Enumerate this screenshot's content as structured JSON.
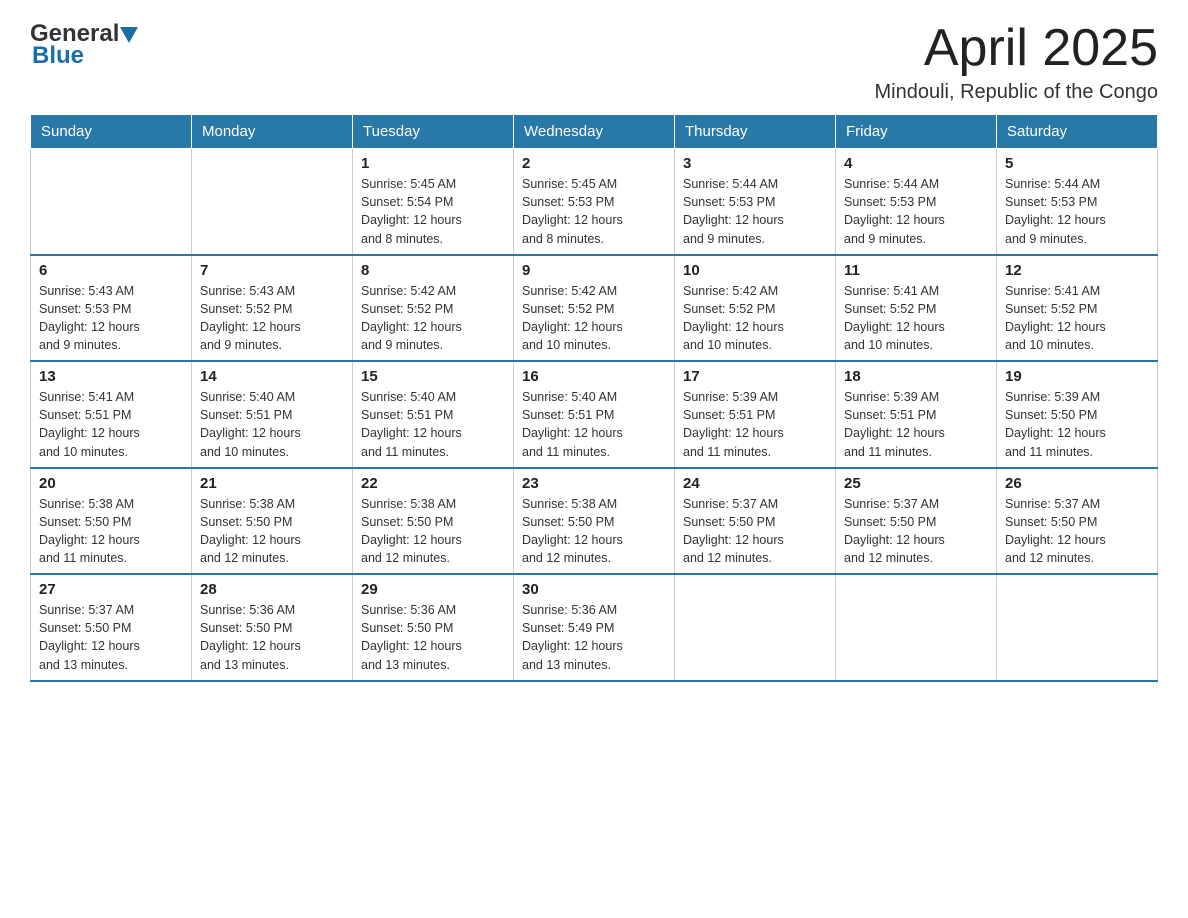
{
  "header": {
    "logo": {
      "general": "General",
      "blue": "Blue"
    },
    "title": "April 2025",
    "subtitle": "Mindouli, Republic of the Congo"
  },
  "calendar": {
    "weekdays": [
      "Sunday",
      "Monday",
      "Tuesday",
      "Wednesday",
      "Thursday",
      "Friday",
      "Saturday"
    ],
    "weeks": [
      [
        {
          "day": "",
          "info": ""
        },
        {
          "day": "",
          "info": ""
        },
        {
          "day": "1",
          "info": "Sunrise: 5:45 AM\nSunset: 5:54 PM\nDaylight: 12 hours\nand 8 minutes."
        },
        {
          "day": "2",
          "info": "Sunrise: 5:45 AM\nSunset: 5:53 PM\nDaylight: 12 hours\nand 8 minutes."
        },
        {
          "day": "3",
          "info": "Sunrise: 5:44 AM\nSunset: 5:53 PM\nDaylight: 12 hours\nand 9 minutes."
        },
        {
          "day": "4",
          "info": "Sunrise: 5:44 AM\nSunset: 5:53 PM\nDaylight: 12 hours\nand 9 minutes."
        },
        {
          "day": "5",
          "info": "Sunrise: 5:44 AM\nSunset: 5:53 PM\nDaylight: 12 hours\nand 9 minutes."
        }
      ],
      [
        {
          "day": "6",
          "info": "Sunrise: 5:43 AM\nSunset: 5:53 PM\nDaylight: 12 hours\nand 9 minutes."
        },
        {
          "day": "7",
          "info": "Sunrise: 5:43 AM\nSunset: 5:52 PM\nDaylight: 12 hours\nand 9 minutes."
        },
        {
          "day": "8",
          "info": "Sunrise: 5:42 AM\nSunset: 5:52 PM\nDaylight: 12 hours\nand 9 minutes."
        },
        {
          "day": "9",
          "info": "Sunrise: 5:42 AM\nSunset: 5:52 PM\nDaylight: 12 hours\nand 10 minutes."
        },
        {
          "day": "10",
          "info": "Sunrise: 5:42 AM\nSunset: 5:52 PM\nDaylight: 12 hours\nand 10 minutes."
        },
        {
          "day": "11",
          "info": "Sunrise: 5:41 AM\nSunset: 5:52 PM\nDaylight: 12 hours\nand 10 minutes."
        },
        {
          "day": "12",
          "info": "Sunrise: 5:41 AM\nSunset: 5:52 PM\nDaylight: 12 hours\nand 10 minutes."
        }
      ],
      [
        {
          "day": "13",
          "info": "Sunrise: 5:41 AM\nSunset: 5:51 PM\nDaylight: 12 hours\nand 10 minutes."
        },
        {
          "day": "14",
          "info": "Sunrise: 5:40 AM\nSunset: 5:51 PM\nDaylight: 12 hours\nand 10 minutes."
        },
        {
          "day": "15",
          "info": "Sunrise: 5:40 AM\nSunset: 5:51 PM\nDaylight: 12 hours\nand 11 minutes."
        },
        {
          "day": "16",
          "info": "Sunrise: 5:40 AM\nSunset: 5:51 PM\nDaylight: 12 hours\nand 11 minutes."
        },
        {
          "day": "17",
          "info": "Sunrise: 5:39 AM\nSunset: 5:51 PM\nDaylight: 12 hours\nand 11 minutes."
        },
        {
          "day": "18",
          "info": "Sunrise: 5:39 AM\nSunset: 5:51 PM\nDaylight: 12 hours\nand 11 minutes."
        },
        {
          "day": "19",
          "info": "Sunrise: 5:39 AM\nSunset: 5:50 PM\nDaylight: 12 hours\nand 11 minutes."
        }
      ],
      [
        {
          "day": "20",
          "info": "Sunrise: 5:38 AM\nSunset: 5:50 PM\nDaylight: 12 hours\nand 11 minutes."
        },
        {
          "day": "21",
          "info": "Sunrise: 5:38 AM\nSunset: 5:50 PM\nDaylight: 12 hours\nand 12 minutes."
        },
        {
          "day": "22",
          "info": "Sunrise: 5:38 AM\nSunset: 5:50 PM\nDaylight: 12 hours\nand 12 minutes."
        },
        {
          "day": "23",
          "info": "Sunrise: 5:38 AM\nSunset: 5:50 PM\nDaylight: 12 hours\nand 12 minutes."
        },
        {
          "day": "24",
          "info": "Sunrise: 5:37 AM\nSunset: 5:50 PM\nDaylight: 12 hours\nand 12 minutes."
        },
        {
          "day": "25",
          "info": "Sunrise: 5:37 AM\nSunset: 5:50 PM\nDaylight: 12 hours\nand 12 minutes."
        },
        {
          "day": "26",
          "info": "Sunrise: 5:37 AM\nSunset: 5:50 PM\nDaylight: 12 hours\nand 12 minutes."
        }
      ],
      [
        {
          "day": "27",
          "info": "Sunrise: 5:37 AM\nSunset: 5:50 PM\nDaylight: 12 hours\nand 13 minutes."
        },
        {
          "day": "28",
          "info": "Sunrise: 5:36 AM\nSunset: 5:50 PM\nDaylight: 12 hours\nand 13 minutes."
        },
        {
          "day": "29",
          "info": "Sunrise: 5:36 AM\nSunset: 5:50 PM\nDaylight: 12 hours\nand 13 minutes."
        },
        {
          "day": "30",
          "info": "Sunrise: 5:36 AM\nSunset: 5:49 PM\nDaylight: 12 hours\nand 13 minutes."
        },
        {
          "day": "",
          "info": ""
        },
        {
          "day": "",
          "info": ""
        },
        {
          "day": "",
          "info": ""
        }
      ]
    ]
  }
}
